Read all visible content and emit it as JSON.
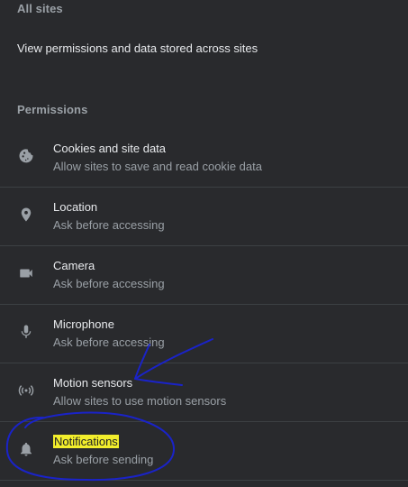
{
  "header": {
    "section_title": "All sites",
    "link_label": "View permissions and data stored across sites"
  },
  "permissions": {
    "section_title": "Permissions",
    "items": [
      {
        "title": "Cookies and site data",
        "subtitle": "Allow sites to save and read cookie data",
        "icon": "cookie-icon"
      },
      {
        "title": "Location",
        "subtitle": "Ask before accessing",
        "icon": "location-pin-icon"
      },
      {
        "title": "Camera",
        "subtitle": "Ask before accessing",
        "icon": "camera-icon"
      },
      {
        "title": "Microphone",
        "subtitle": "Ask before accessing",
        "icon": "microphone-icon"
      },
      {
        "title": "Motion sensors",
        "subtitle": "Allow sites to use motion sensors",
        "icon": "motion-sensor-icon"
      },
      {
        "title": "Notifications",
        "subtitle": "Ask before sending",
        "icon": "bell-icon"
      }
    ]
  },
  "colors": {
    "background": "#292a2d",
    "primary_text": "#e8eaed",
    "secondary_text": "#9aa0a6",
    "divider": "#3c4043",
    "highlight": "#f2ee2c",
    "annotation_ink": "#1a23c8"
  }
}
